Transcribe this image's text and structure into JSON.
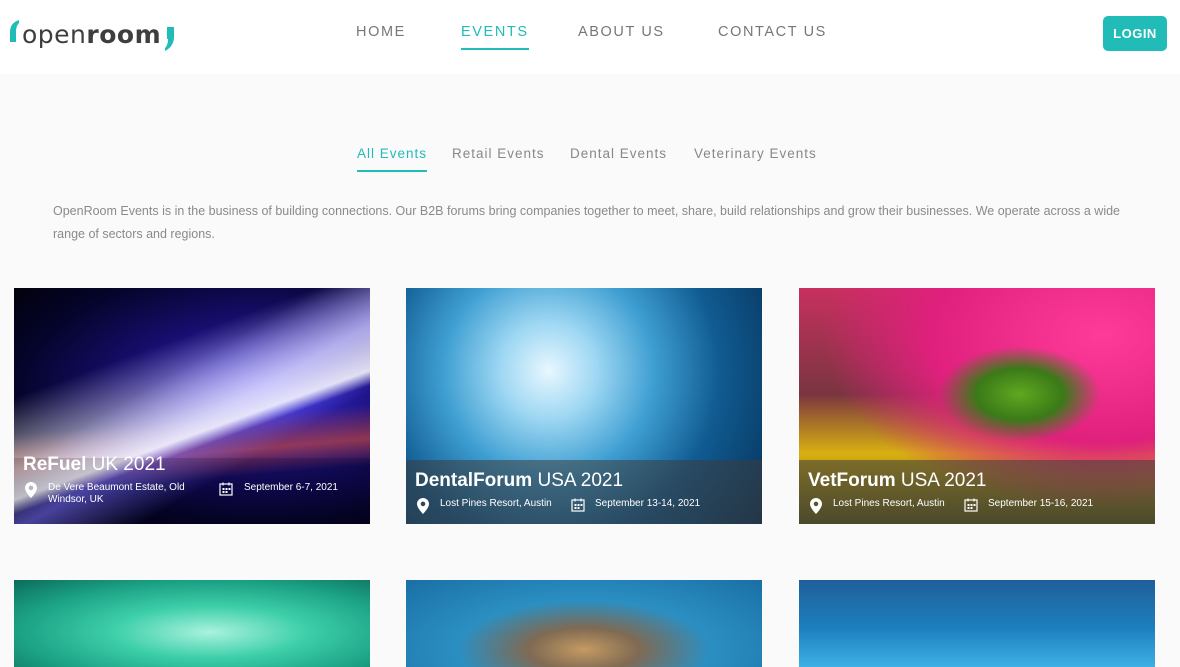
{
  "brand": {
    "name_light": "open",
    "name_bold": "room",
    "accent": "#21bcb7"
  },
  "nav": {
    "home": "HOME",
    "events": "EVENTS",
    "about": "ABOUT US",
    "contact": "CONTACT US",
    "active": "EVENTS"
  },
  "login_label": "LOGIN",
  "tabs": {
    "all": "All Events",
    "retail": "Retail Events",
    "dental": "Dental Events",
    "vet": "Veterinary Events",
    "active": "All Events"
  },
  "intro": "OpenRoom Events is in the business of building connections. Our B2B forums bring companies together to meet, share, build relationships and grow their businesses. We operate across a wide range of sectors and regions.",
  "events": [
    {
      "name_bold": "ReFuel",
      "name_rest": " UK 2021",
      "location": "De Vere Beaumont Estate, Old Windsor, UK",
      "date": "September 6-7, 2021",
      "location_icon": "map-pin-icon",
      "date_icon": "calendar-icon"
    },
    {
      "name_bold": "DentalForum",
      "name_rest": " USA 2021",
      "location": "Lost Pines Resort, Austin",
      "date": "September 13-14, 2021",
      "location_icon": "map-pin-icon",
      "date_icon": "calendar-icon"
    },
    {
      "name_bold": "VetForum",
      "name_rest": " USA 2021",
      "location": "Lost Pines Resort, Austin",
      "date": "September 15-16, 2021",
      "location_icon": "map-pin-icon",
      "date_icon": "calendar-icon"
    }
  ]
}
